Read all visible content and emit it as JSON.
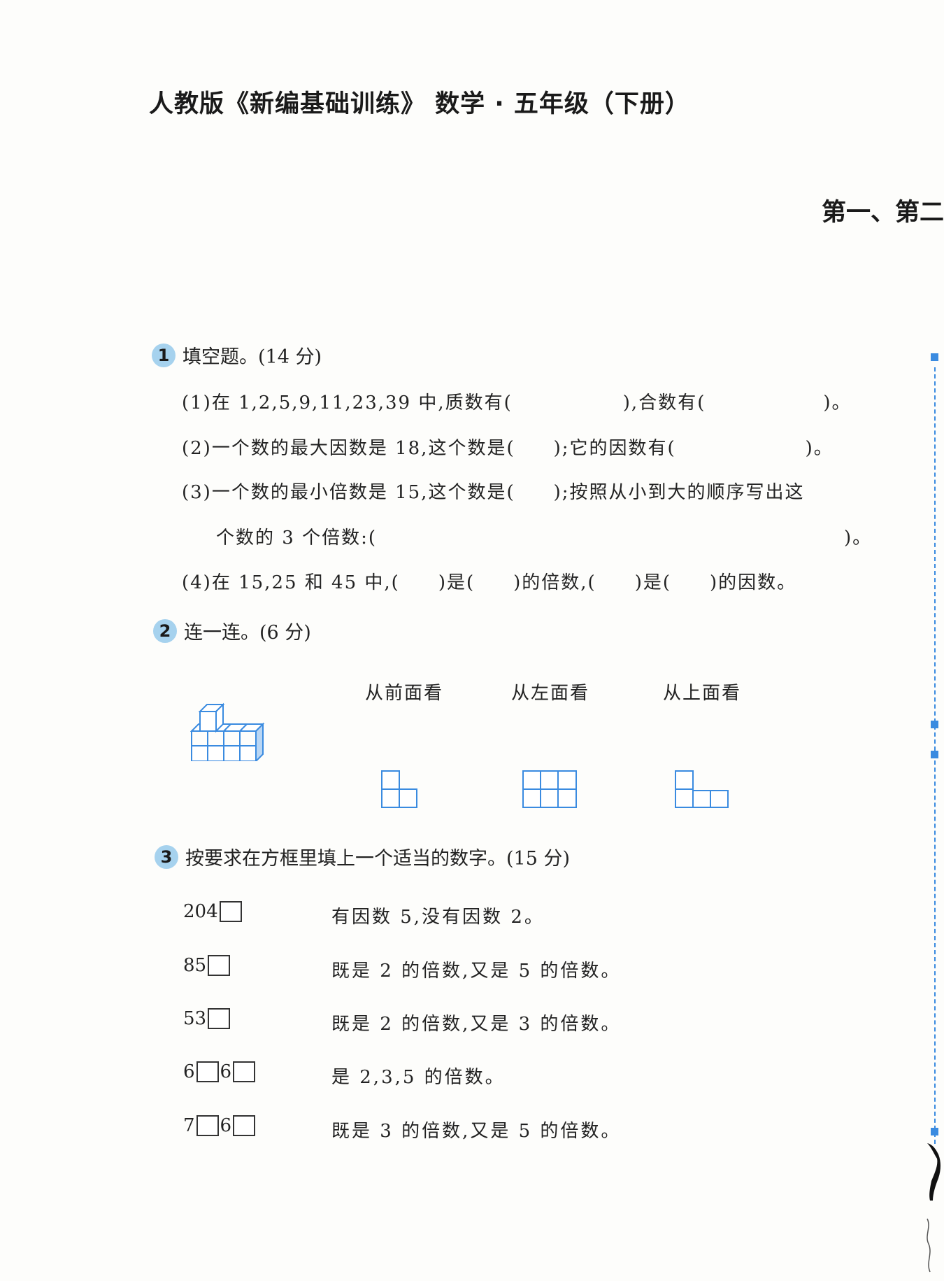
{
  "header": {
    "title": "人教版《新编基础训练》 数学 · 五年级（下册）"
  },
  "chapter": {
    "title": "第一、第二"
  },
  "section1": {
    "number": "1",
    "title": "填空题。(14 分)",
    "items": [
      {
        "a": "(1)在 1,2,5,9,11,23,39 中,质数有(",
        "b": "),合数有(",
        "c": ")。"
      },
      {
        "a": "(2)一个数的最大因数是 18,这个数是(",
        "b": ");它的因数有(",
        "c": ")。"
      },
      {
        "a": "(3)一个数的最小倍数是 15,这个数是(",
        "b": ");按照从小到大的顺序写出这"
      },
      {
        "a": "个数的 3 个倍数:(",
        "b": ")。"
      },
      {
        "a": "(4)在 15,25 和 45 中,(",
        "b": ")是(",
        "c": ")的倍数,(",
        "d": ")是(",
        "e": ")的因数。"
      }
    ]
  },
  "section2": {
    "number": "2",
    "title": "连一连。(6 分)",
    "views": [
      "从前面看",
      "从左面看",
      "从上面看"
    ]
  },
  "section3": {
    "number": "3",
    "title": "按要求在方框里填上一个适当的数字。(15 分)",
    "rows": [
      {
        "parts": [
          "204"
        ],
        "boxes_after": [
          true
        ],
        "req": "有因数 5,没有因数 2。"
      },
      {
        "parts": [
          "85"
        ],
        "boxes_after": [
          true
        ],
        "req": "既是 2 的倍数,又是 5 的倍数。"
      },
      {
        "parts": [
          "53"
        ],
        "boxes_after": [
          true
        ],
        "req": "既是 2 的倍数,又是 3 的倍数。"
      },
      {
        "parts": [
          "6",
          "6"
        ],
        "boxes_after": [
          true,
          true
        ],
        "req": "是 2,3,5 的倍数。"
      },
      {
        "parts": [
          "7",
          "6"
        ],
        "boxes_after": [
          true,
          true
        ],
        "req": "既是 3 的倍数,又是 5 的倍数。"
      }
    ]
  },
  "colors": {
    "accent": "#3a8be0",
    "badge": "#a6d2ee"
  }
}
